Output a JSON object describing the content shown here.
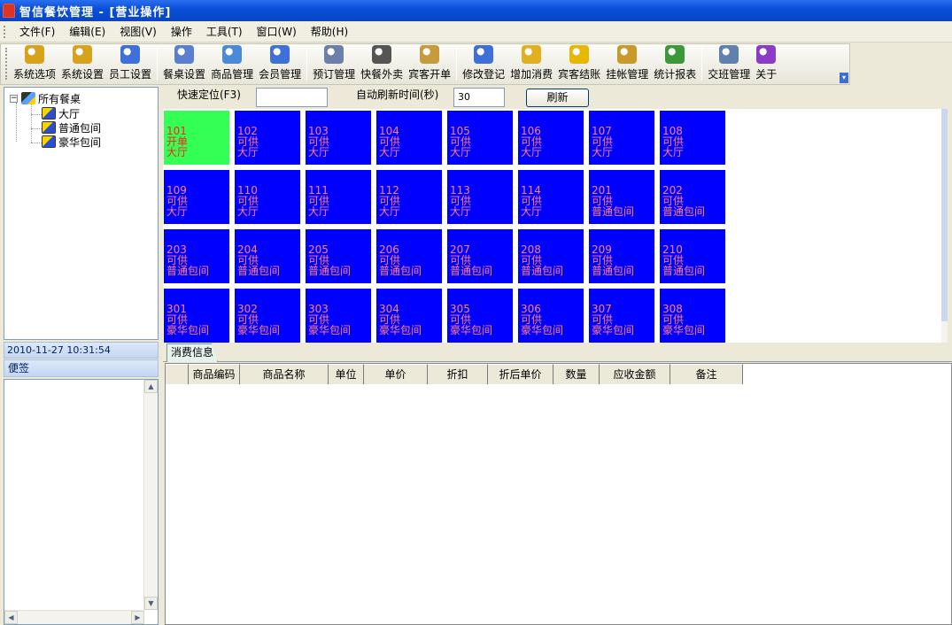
{
  "window": {
    "title": "智信餐饮管理 - [营业操作]"
  },
  "menu": [
    "文件(F)",
    "编辑(E)",
    "视图(V)",
    "操作",
    "工具(T)",
    "窗口(W)",
    "帮助(H)"
  ],
  "toolbar": [
    {
      "label": "系统选项",
      "icon": "key-icon",
      "color": "#d9a21b"
    },
    {
      "label": "系统设置",
      "icon": "key-settings-icon",
      "color": "#d9a21b"
    },
    {
      "label": "员工设置",
      "icon": "person-icon",
      "color": "#3f6fd8"
    },
    {
      "sep": true
    },
    {
      "label": "餐桌设置",
      "icon": "table-icon",
      "color": "#5a7fd0"
    },
    {
      "label": "商品管理",
      "icon": "product-icon",
      "color": "#4a8ad8"
    },
    {
      "label": "会员管理",
      "icon": "member-icon",
      "color": "#3f6fd8"
    },
    {
      "sep": true
    },
    {
      "label": "预订管理",
      "icon": "phone-icon",
      "color": "#6b7fa8"
    },
    {
      "label": "快餐外卖",
      "icon": "mobile-icon",
      "color": "#555"
    },
    {
      "label": "宾客开单",
      "icon": "box-icon",
      "color": "#c79a3b"
    },
    {
      "sep": true
    },
    {
      "label": "修改登记",
      "icon": "edit-person-icon",
      "color": "#3f6fd8"
    },
    {
      "label": "增加消费",
      "icon": "add-consume-icon",
      "color": "#e0b020"
    },
    {
      "label": "宾客结账",
      "icon": "yen-coin-icon",
      "color": "#e8b800"
    },
    {
      "label": "挂帐管理",
      "icon": "money-bag-icon",
      "color": "#c99a2a"
    },
    {
      "label": "统计报表",
      "icon": "chart-icon",
      "color": "#3a9a3a"
    },
    {
      "sep": true
    },
    {
      "label": "交班管理",
      "icon": "handover-icon",
      "color": "#6080b0"
    },
    {
      "label": "关于",
      "icon": "question-icon",
      "color": "#8a3cc8"
    }
  ],
  "tree": {
    "root": "所有餐桌",
    "children": [
      "大厅",
      "普通包间",
      "豪华包间"
    ]
  },
  "datetime": "2010-11-27  10:31:54",
  "notes": {
    "header": "便签"
  },
  "locate": {
    "label": "快速定位(F3)",
    "value": ""
  },
  "refresh": {
    "label": "自动刷新时间(秒)",
    "value": "30",
    "button": "刷新"
  },
  "tables": [
    {
      "no": "101",
      "status": "开单",
      "area": "大厅",
      "open": true
    },
    {
      "no": "102",
      "status": "可供",
      "area": "大厅"
    },
    {
      "no": "103",
      "status": "可供",
      "area": "大厅"
    },
    {
      "no": "104",
      "status": "可供",
      "area": "大厅"
    },
    {
      "no": "105",
      "status": "可供",
      "area": "大厅"
    },
    {
      "no": "106",
      "status": "可供",
      "area": "大厅"
    },
    {
      "no": "107",
      "status": "可供",
      "area": "大厅"
    },
    {
      "no": "108",
      "status": "可供",
      "area": "大厅"
    },
    {
      "no": "109",
      "status": "可供",
      "area": "大厅"
    },
    {
      "no": "110",
      "status": "可供",
      "area": "大厅"
    },
    {
      "no": "111",
      "status": "可供",
      "area": "大厅"
    },
    {
      "no": "112",
      "status": "可供",
      "area": "大厅"
    },
    {
      "no": "113",
      "status": "可供",
      "area": "大厅"
    },
    {
      "no": "114",
      "status": "可供",
      "area": "大厅"
    },
    {
      "no": "201",
      "status": "可供",
      "area": "普通包间"
    },
    {
      "no": "202",
      "status": "可供",
      "area": "普通包间"
    },
    {
      "no": "203",
      "status": "可供",
      "area": "普通包间"
    },
    {
      "no": "204",
      "status": "可供",
      "area": "普通包间"
    },
    {
      "no": "205",
      "status": "可供",
      "area": "普通包间"
    },
    {
      "no": "206",
      "status": "可供",
      "area": "普通包间"
    },
    {
      "no": "207",
      "status": "可供",
      "area": "普通包间"
    },
    {
      "no": "208",
      "status": "可供",
      "area": "普通包间"
    },
    {
      "no": "209",
      "status": "可供",
      "area": "普通包间"
    },
    {
      "no": "210",
      "status": "可供",
      "area": "普通包间"
    },
    {
      "no": "301",
      "status": "可供",
      "area": "豪华包间"
    },
    {
      "no": "302",
      "status": "可供",
      "area": "豪华包间"
    },
    {
      "no": "303",
      "status": "可供",
      "area": "豪华包间"
    },
    {
      "no": "304",
      "status": "可供",
      "area": "豪华包间"
    },
    {
      "no": "305",
      "status": "可供",
      "area": "豪华包间"
    },
    {
      "no": "306",
      "status": "可供",
      "area": "豪华包间"
    },
    {
      "no": "307",
      "status": "可供",
      "area": "豪华包间"
    },
    {
      "no": "308",
      "status": "可供",
      "area": "豪华包间"
    }
  ],
  "consumption": {
    "tab": "消费信息",
    "columns": [
      "",
      "商品编码",
      "商品名称",
      "单位",
      "单价",
      "折扣",
      "折后单价",
      "数量",
      "应收金额",
      "备注"
    ]
  },
  "colors": {
    "available": "#0000ff",
    "open": "#33ff55",
    "available_text": "#ff8080",
    "open_text": "#ff2020"
  }
}
